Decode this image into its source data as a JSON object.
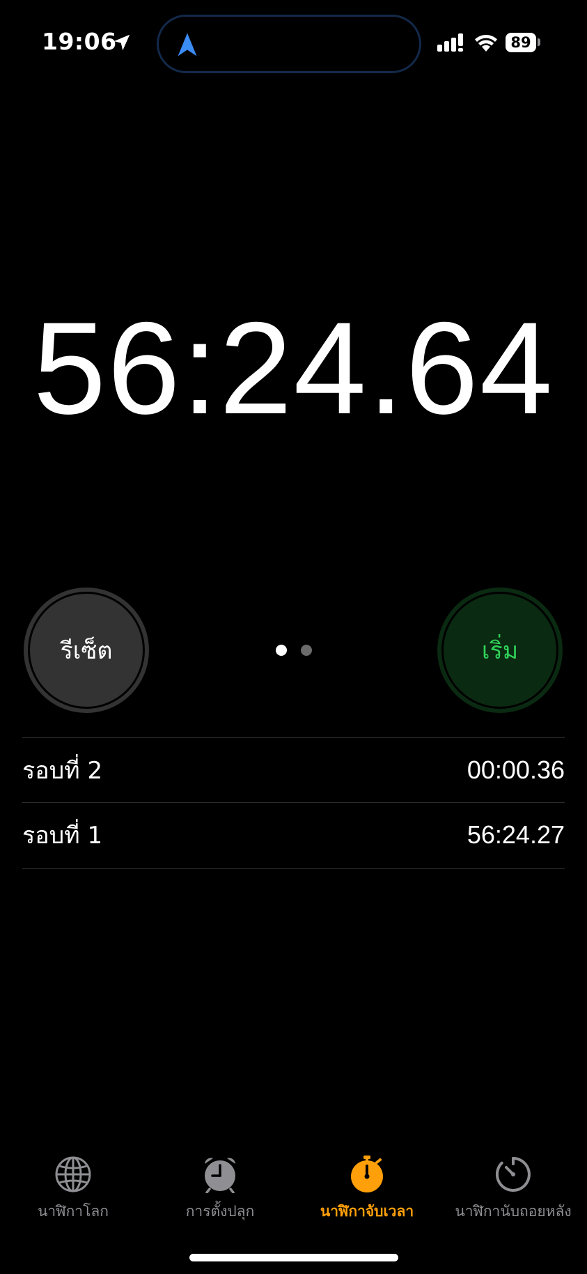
{
  "status_bar": {
    "time": "19:06",
    "battery_level": "89",
    "icons": [
      "location-arrow-icon",
      "navigation-icon",
      "cellular-signal-icon",
      "wifi-icon",
      "battery-icon"
    ]
  },
  "stopwatch": {
    "elapsed": "56:24.64",
    "reset_label": "รีเซ็ต",
    "start_label": "เริ่ม",
    "colors": {
      "start_text": "#30d158",
      "start_bg": "#0a2a12",
      "reset_bg": "#333333"
    }
  },
  "laps": [
    {
      "label": "รอบที่ 2",
      "time": "00:00.36"
    },
    {
      "label": "รอบที่ 1",
      "time": "56:24.27"
    }
  ],
  "tab_bar": {
    "tabs": [
      {
        "label": "นาฬิกาโลก",
        "icon": "globe-icon",
        "active": false
      },
      {
        "label": "การตั้งปลุก",
        "icon": "alarm-clock-icon",
        "active": false
      },
      {
        "label": "นาฬิกาจับเวลา",
        "icon": "stopwatch-icon",
        "active": true
      },
      {
        "label": "นาฬิกานับถอยหลัง",
        "icon": "timer-icon",
        "active": false
      }
    ],
    "active_color": "#ff9f0a",
    "inactive_color": "#8e8e93"
  }
}
